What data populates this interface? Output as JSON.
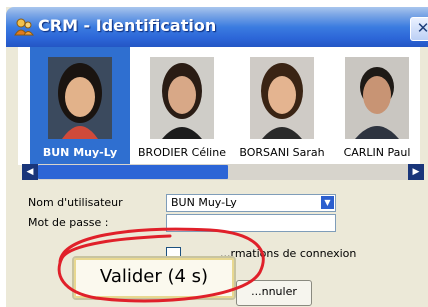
{
  "window": {
    "title": "CRM - Identification",
    "close_glyph": "✕"
  },
  "users": [
    {
      "name": "BUN Muy-Ly",
      "selected": true
    },
    {
      "name": "BRODIER Céline",
      "selected": false
    },
    {
      "name": "BORSANI Sarah",
      "selected": false
    },
    {
      "name": "CARLIN Paul",
      "selected": false
    }
  ],
  "scrollbar": {
    "left_glyph": "◀",
    "right_glyph": "▶"
  },
  "form": {
    "username_label": "Nom d'utilisateur",
    "username_value": "BUN Muy-Ly",
    "password_label": "Mot de passe :",
    "password_value": "",
    "remember_label": "...rmations de connexion",
    "select_arrow_glyph": "▼"
  },
  "buttons": {
    "validate_label": "Valider (4 s)",
    "cancel_label": "...nnuler"
  },
  "colors": {
    "title_bar": "#2c66d8",
    "selection": "#2f6fd0",
    "annotation": "#e0202a"
  },
  "annotation_icon": "red-hand-drawn-circle"
}
